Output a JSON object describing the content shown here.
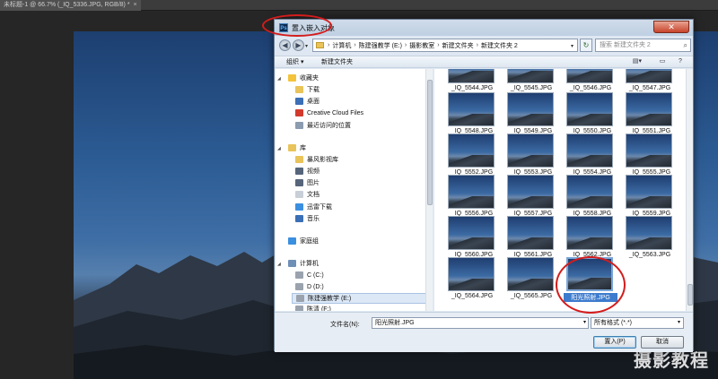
{
  "tab": {
    "title": "未标题-1 @ 66.7% (_IQ_5336.JPG, RGB/8) *",
    "close": "×"
  },
  "dialog": {
    "title": "置入嵌入对象",
    "close": "✕",
    "logo": "Ps",
    "address": [
      "计算机",
      "陈建强教学 (E:)",
      "摄影教室",
      "新建文件夹",
      "新建文件夹 2"
    ],
    "search_placeholder": "搜索 新建文件夹 2",
    "toolbar": {
      "organize": "组织 ▾",
      "new_folder": "新建文件夹"
    },
    "nav": [
      {
        "label": "收藏夹",
        "icon": "star-icon",
        "color": "#f3c33b"
      },
      {
        "label": "下载",
        "icon": "download-folder-icon",
        "color": "#e9c45b"
      },
      {
        "label": "桌面",
        "icon": "desktop-icon",
        "color": "#3b6fb6"
      },
      {
        "label": "Creative Cloud Files",
        "icon": "creative-cloud-icon",
        "color": "#d23a2e"
      },
      {
        "label": "最近访问的位置",
        "icon": "recent-places-icon",
        "color": "#8b9bb0"
      },
      {
        "label": "库",
        "icon": "library-icon",
        "color": "#e9c45b"
      },
      {
        "label": "暴风影视库",
        "icon": "video-library-icon",
        "color": "#e9c45b"
      },
      {
        "label": "视频",
        "icon": "video-icon",
        "color": "#56657a"
      },
      {
        "label": "图片",
        "icon": "picture-icon",
        "color": "#56657a"
      },
      {
        "label": "文档",
        "icon": "document-icon",
        "color": "#c9cfd7"
      },
      {
        "label": "迅雷下载",
        "icon": "thunder-download-icon",
        "color": "#3b8fe0"
      },
      {
        "label": "音乐",
        "icon": "music-icon",
        "color": "#3b6fb6"
      },
      {
        "label": "家庭组",
        "icon": "homegroup-icon",
        "color": "#3b8fe0"
      },
      {
        "label": "计算机",
        "icon": "computer-icon",
        "color": "#6f8fb6"
      },
      {
        "label": "C (C:)",
        "icon": "drive-c-icon",
        "color": "#9aa3ad"
      },
      {
        "label": "D (D:)",
        "icon": "drive-d-icon",
        "color": "#9aa3ad"
      },
      {
        "label": "陈建强教学 (E:)",
        "icon": "drive-e-icon",
        "color": "#9aa3ad"
      },
      {
        "label": "陈清 (F:)",
        "icon": "drive-f-icon",
        "color": "#9aa3ad"
      }
    ],
    "files_cut": [
      "_IQ_5544.JPG",
      "_IQ_5545.JPG",
      "_IQ_5546.JPG",
      "_IQ_5547.JPG"
    ],
    "files": [
      [
        "_IQ_5548.JPG",
        "_IQ_5549.JPG",
        "_IQ_5550.JPG",
        "_IQ_5551.JPG"
      ],
      [
        "_IQ_5552.JPG",
        "_IQ_5553.JPG",
        "_IQ_5554.JPG",
        "_IQ_5555.JPG"
      ],
      [
        "_IQ_5556.JPG",
        "_IQ_5557.JPG",
        "_IQ_5558.JPG",
        "_IQ_5559.JPG"
      ],
      [
        "_IQ_5560.JPG",
        "_IQ_5561.JPG",
        "_IQ_5562.JPG",
        "_IQ_5563.JPG"
      ],
      [
        "_IQ_5564.JPG",
        "_IQ_5565.JPG",
        "阳光照射.JPG"
      ]
    ],
    "selected_file": "阳光照射.JPG",
    "filename_label": "文件名(N):",
    "filename_value": "阳光照射.JPG",
    "filetype_value": "所有格式 (*.*)",
    "place_button": "置入(P)",
    "cancel_button": "取消"
  },
  "watermark": "摄影教程"
}
